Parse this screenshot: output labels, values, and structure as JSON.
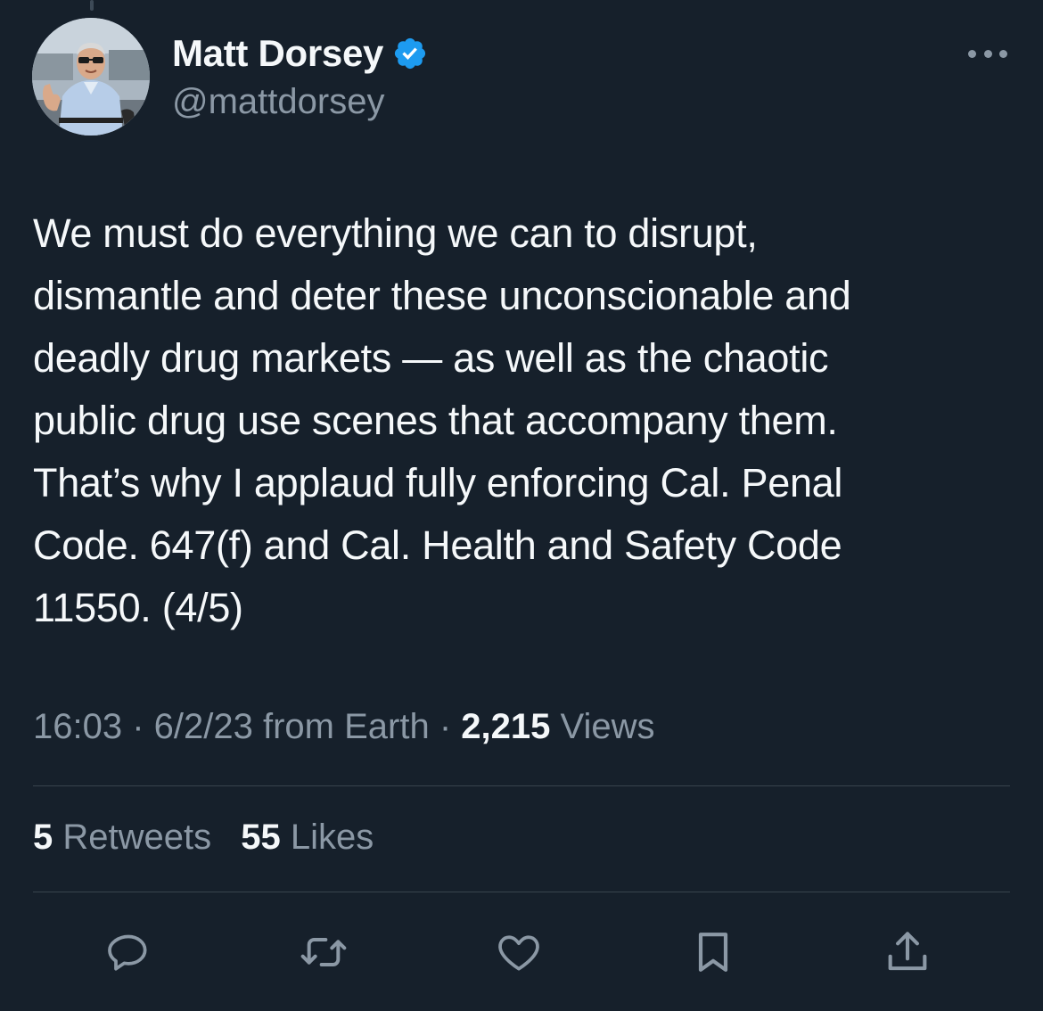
{
  "author": {
    "display_name": "Matt Dorsey",
    "handle": "@mattdorsey",
    "verified": true,
    "verified_color": "#1d9bf0"
  },
  "tweet": {
    "text": "We must do everything we can to disrupt,\ndismantle and deter these unconscionable and\ndeadly drug markets — as well as the chaotic\npublic drug use scenes that accompany them.\nThat’s why I applaud fully enforcing Cal. Penal\nCode. 647(f) and Cal. Health and Safety Code\n11550. (4/5)",
    "time": "16:03",
    "date": "6/2/23",
    "source": "from Earth",
    "separator": " · ",
    "views_count": "2,215",
    "views_label": "Views"
  },
  "stats": {
    "retweets_count": "5",
    "retweets_label": "Retweets",
    "likes_count": "55",
    "likes_label": "Likes"
  },
  "actions": [
    {
      "icon": "reply-icon"
    },
    {
      "icon": "retweet-icon"
    },
    {
      "icon": "like-icon"
    },
    {
      "icon": "bookmark-icon"
    },
    {
      "icon": "share-icon"
    }
  ],
  "colors": {
    "background": "#16202b",
    "text_primary": "#f5f8fa",
    "text_secondary": "#8b98a5",
    "divider": "#38444d"
  }
}
